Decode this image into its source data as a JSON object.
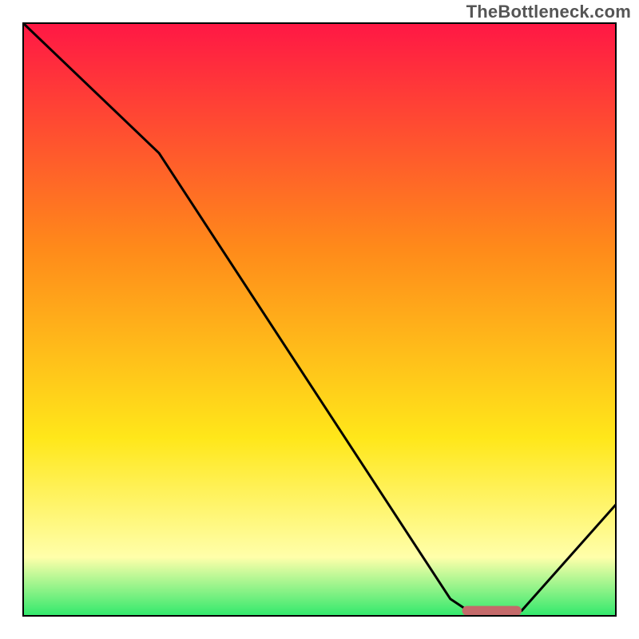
{
  "watermark": "TheBottleneck.com",
  "colors": {
    "frame": "#000000",
    "curve": "#000000",
    "marker_fill": "#c46a6a",
    "grad_top": "#ff1745",
    "grad_mid1": "#ff8a1a",
    "grad_mid2": "#ffe71a",
    "grad_mid3": "#ffffaa",
    "grad_bottom": "#2ee86b"
  },
  "chart_data": {
    "type": "line",
    "title": "",
    "xlabel": "",
    "ylabel": "",
    "xlim": [
      0,
      100
    ],
    "ylim": [
      0,
      100
    ],
    "x": [
      0,
      23,
      72,
      75,
      84,
      100
    ],
    "values": [
      100,
      78,
      3,
      1,
      1,
      19
    ],
    "marker": {
      "x_range": [
        74,
        84
      ],
      "y": 1
    }
  }
}
